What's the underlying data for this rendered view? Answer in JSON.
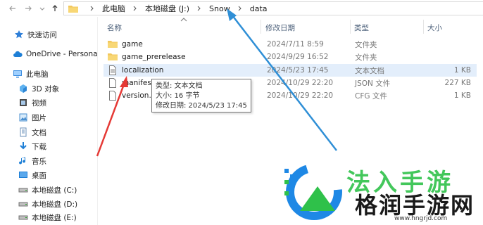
{
  "address_bar": {
    "crumbs": [
      "此电脑",
      "本地磁盘 (J:)",
      "Snow",
      "data"
    ]
  },
  "sidebar": {
    "items": [
      {
        "label": "快速访问",
        "icon": "star-icon"
      },
      {
        "label": "OneDrive - Persona",
        "icon": "cloud-icon"
      },
      {
        "label": "此电脑",
        "icon": "computer-icon"
      },
      {
        "label": "3D 对象",
        "icon": "cube-icon"
      },
      {
        "label": "视频",
        "icon": "video-icon"
      },
      {
        "label": "图片",
        "icon": "picture-icon"
      },
      {
        "label": "文档",
        "icon": "document-icon"
      },
      {
        "label": "下载",
        "icon": "download-icon"
      },
      {
        "label": "音乐",
        "icon": "music-icon"
      },
      {
        "label": "桌面",
        "icon": "desktop-icon"
      },
      {
        "label": "本地磁盘 (C:)",
        "icon": "drive-icon"
      },
      {
        "label": "本地磁盘 (D:)",
        "icon": "drive-icon"
      },
      {
        "label": "本地磁盘 (E:)",
        "icon": "drive-icon"
      }
    ]
  },
  "columns": {
    "name": "名称",
    "date": "修改日期",
    "type": "类型",
    "size": "大小"
  },
  "files": [
    {
      "name": "game",
      "date": "2024/7/11 8:59",
      "type": "文件夹",
      "size": "",
      "icon": "folder-icon"
    },
    {
      "name": "game_prerelease",
      "date": "2024/9/29 16:52",
      "type": "文件夹",
      "size": "",
      "icon": "folder-icon"
    },
    {
      "name": "localization",
      "date": "2024/5/23 17:45",
      "type": "文本文档",
      "size": "1 KB",
      "icon": "text-file-icon"
    },
    {
      "name": "manifest",
      "date": "2024/10/29 22:20",
      "type": "JSON 文件",
      "size": "227 KB",
      "icon": "file-icon"
    },
    {
      "name": "version.c",
      "date": "2024/10/29 22:20",
      "type": "CFG 文件",
      "size": "1 KB",
      "icon": "file-icon"
    }
  ],
  "tooltip": {
    "line1": "类型: 文本文档",
    "line2": "大小: 16 字节",
    "line3": "修改日期: 2024/5/23 17:45"
  },
  "watermark": {
    "top": "法入手游",
    "main": "格润手游网",
    "url": "www.hngrjd.com"
  },
  "colors": {
    "accent_arrow_red": "#e53935",
    "accent_arrow_blue": "#2f8fd6",
    "selected_row": "#e3eefb",
    "logo_green": "#2fc14a",
    "logo_blue": "#1e88e5"
  }
}
